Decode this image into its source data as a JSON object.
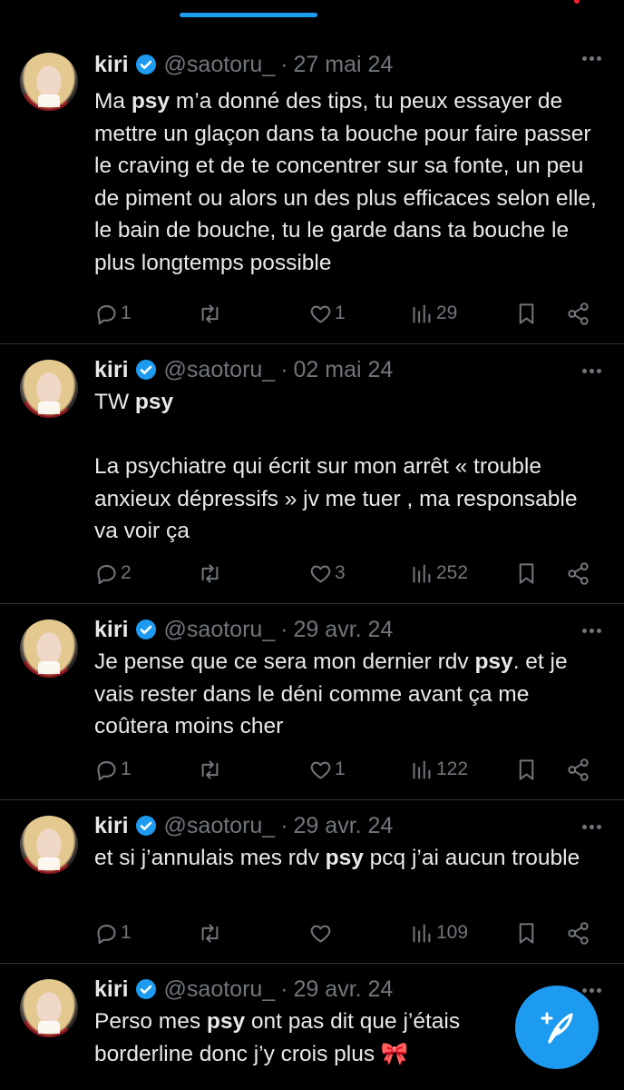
{
  "tweets": [
    {
      "name": "kiri",
      "handle": "@saotoru_",
      "date": "27 mai 24",
      "text_parts": [
        "Ma ",
        "psy",
        " m’a donné des tips, tu peux essayer de mettre un glaçon dans ta bouche pour faire passer le craving et de te concentrer sur sa fonte, un peu de piment ou alors un des plus efficaces selon elle, le bain de bouche, tu le garde dans ta bouche le plus longtemps possible"
      ],
      "replies": "1",
      "retweets": "",
      "likes": "1",
      "views": "29"
    },
    {
      "name": "kiri",
      "handle": "@saotoru_",
      "date": "02 mai 24",
      "text_parts": [
        "TW ",
        "psy",
        "\n\nLa psychiatre qui écrit sur mon arrêt « trouble anxieux dépressifs » jv me tuer , ma responsable va voir ça"
      ],
      "replies": "2",
      "retweets": "",
      "likes": "3",
      "views": "252"
    },
    {
      "name": "kiri",
      "handle": "@saotoru_",
      "date": "29 avr. 24",
      "text_parts": [
        "Je pense que ce sera mon dernier rdv ",
        "psy",
        ". et je vais rester dans le déni comme avant ça me coûtera moins cher"
      ],
      "replies": "1",
      "retweets": "",
      "likes": "1",
      "views": "122"
    },
    {
      "name": "kiri",
      "handle": "@saotoru_",
      "date": "29 avr. 24",
      "text_parts": [
        "et si j’annulais mes rdv ",
        "psy",
        " pcq j’ai aucun trouble"
      ],
      "replies": "1",
      "retweets": "",
      "likes": "",
      "views": "109"
    },
    {
      "name": "kiri",
      "handle": "@saotoru_",
      "date": "29 avr. 24",
      "text_parts": [
        "Perso mes ",
        "psy",
        " ont pas dit que j’étais borderline donc j’y crois plus 🎀"
      ]
    }
  ],
  "separator": "·",
  "icons": {
    "verified": "verified-badge-icon",
    "reply": "reply-icon",
    "retweet": "retweet-icon",
    "like": "heart-icon",
    "views": "views-icon",
    "bookmark": "bookmark-icon",
    "share": "share-icon",
    "compose": "compose-icon"
  },
  "colors": {
    "accent": "#1d9bf0",
    "muted": "#71767b",
    "text": "#e7e9ea",
    "notification": "#f4212e"
  }
}
